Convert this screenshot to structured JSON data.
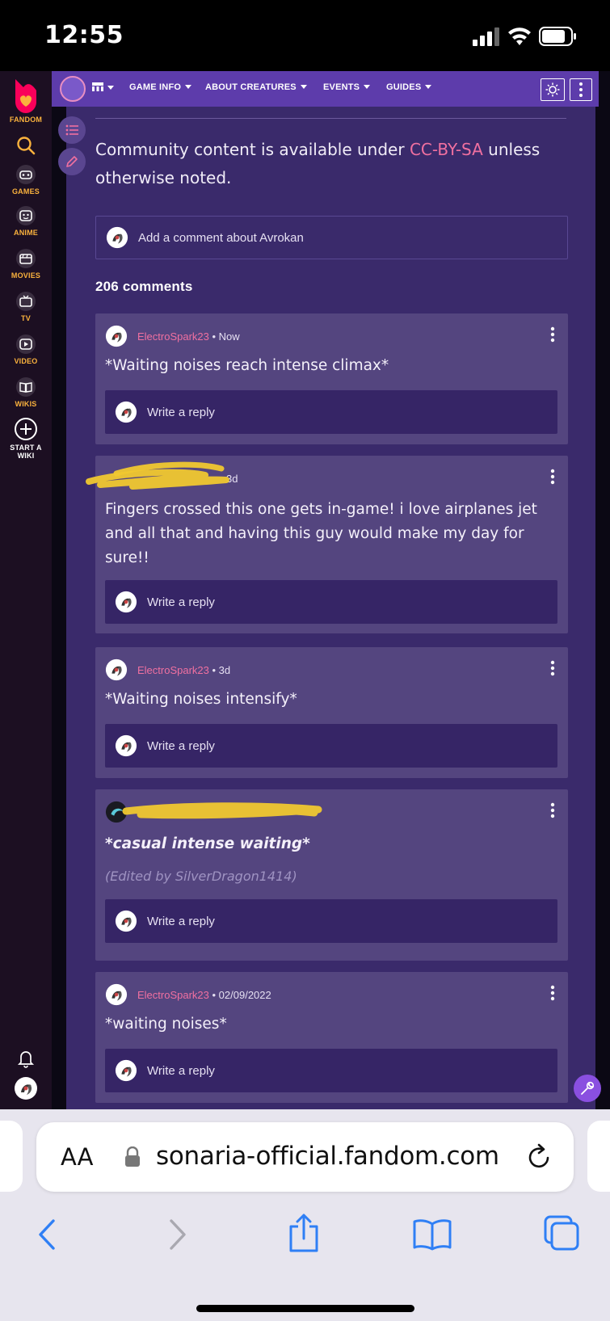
{
  "status_bar": {
    "time": "12:55"
  },
  "global_nav": {
    "brand": "FANDOM",
    "items": [
      {
        "id": "games",
        "label": "GAMES",
        "icon": "controller-icon"
      },
      {
        "id": "anime",
        "label": "ANIME",
        "icon": "anime-face-icon"
      },
      {
        "id": "movies",
        "label": "MOVIES",
        "icon": "clapperboard-icon"
      },
      {
        "id": "tv",
        "label": "TV",
        "icon": "tv-icon"
      },
      {
        "id": "video",
        "label": "VIDEO",
        "icon": "play-icon"
      },
      {
        "id": "wikis",
        "label": "WIKIS",
        "icon": "book-icon"
      },
      {
        "id": "start",
        "label": "START A WIKI",
        "icon": "plus-circle-icon"
      }
    ]
  },
  "local_nav": {
    "items": [
      "GAME INFO",
      "ABOUT CREATURES",
      "EVENTS",
      "GUIDES"
    ]
  },
  "license": {
    "prefix": "Community content is available under ",
    "link": "CC-BY-SA",
    "suffix": " unless otherwise noted."
  },
  "comments": {
    "add_placeholder": "Add a comment about Avrokan",
    "count_label": "206 comments",
    "reply_placeholder": "Write a reply",
    "items": [
      {
        "author": "ElectroSpark23",
        "time": "Now",
        "text": "*Waiting noises reach intense climax*"
      },
      {
        "author": "",
        "time": "3d",
        "text": "Fingers crossed this one gets in-game! i love airplanes jet and all that and having this guy would make my day for sure!!"
      },
      {
        "author": "ElectroSpark23",
        "time": "3d",
        "text": "*Waiting noises intensify*"
      },
      {
        "author": "",
        "time": "",
        "text": "*casual intense waiting*",
        "edited": "(Edited by SilverDragon1414)"
      },
      {
        "author": "ElectroSpark23",
        "time": "02/09/2022",
        "text": "*waiting noises*"
      }
    ]
  },
  "safari": {
    "aa": "AA",
    "url": "sonaria-official.fandom.com"
  },
  "colors": {
    "accent_pink": "#f070a0",
    "local_nav": "#5d3cab",
    "content_bg": "#3a2a6b",
    "card_bg": "#54457f",
    "reply_bg": "#362566",
    "fandom_gold": "#fab23d",
    "highlighter": "#f0c830"
  }
}
